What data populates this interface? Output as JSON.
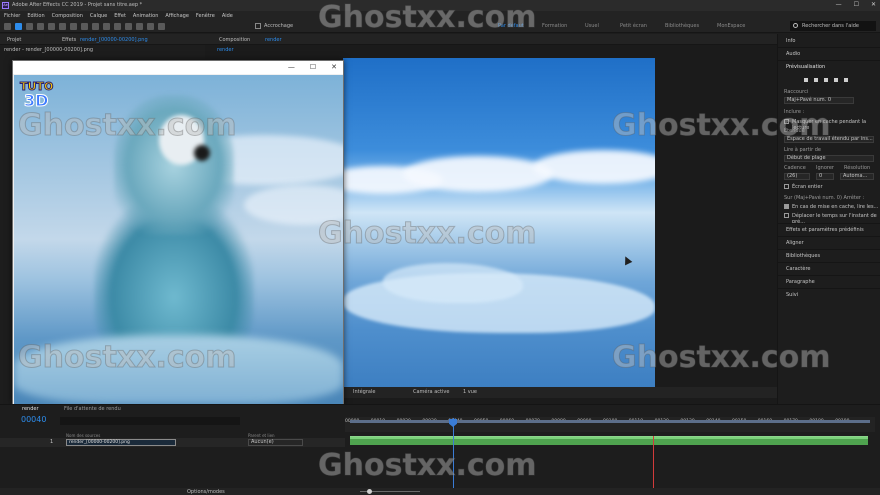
{
  "app": {
    "title": "Adobe After Effects CC 2019 - Projet sans titre.aep *",
    "logo_text": "Ae",
    "window_controls": [
      "—",
      "☐",
      "✕"
    ]
  },
  "menu": [
    "Fichier",
    "Edition",
    "Composition",
    "Calque",
    "Effet",
    "Animation",
    "Affichage",
    "Fenêtre",
    "Aide"
  ],
  "toolbar": {
    "snap_label": "Accrochage",
    "workspaces": [
      {
        "label": "Par défaut",
        "active": true
      },
      {
        "label": "Formation",
        "active": false
      },
      {
        "label": "Usuel",
        "active": false
      },
      {
        "label": "Petit écran",
        "active": false
      },
      {
        "label": "Bibliothèques",
        "active": false
      },
      {
        "label": "MonEspace",
        "active": false
      }
    ],
    "search_help_placeholder": "Rechercher dans l'aide"
  },
  "project_panel": {
    "tab_project": "Projet",
    "tab_effects_prefix": "Effets",
    "tab_effects_name": "render_[00000-00200].png",
    "file_name": "render - render_[00000-00200].png"
  },
  "composition_panel": {
    "tab_label": "Composition",
    "comp_name": "render",
    "sub_tab": "render",
    "bottom_controls": {
      "resolution": "Intégrale",
      "camera": "Caméra active",
      "views": "1 vue"
    }
  },
  "popup": {
    "logo_line1": "TUTO",
    "logo_line2": "3D",
    "controls": [
      "—",
      "☐",
      "✕"
    ]
  },
  "right_panel": {
    "info": "Info",
    "audio": "Audio",
    "preview": "Prévisualisation",
    "raccourci_label": "Raccourci",
    "raccourci_value": "Maj+Pavé num. 0",
    "inclure": "Inclure :",
    "masquer_lecture": "Masquer en cache pendant la lecture",
    "etendue_label": "Étendue",
    "etendue_value": "Espace de travail étendu par ins...",
    "lire_partir": "Lire à partir de",
    "lire_value": "Début de plage",
    "cadence": "Cadence",
    "ignorer": "Ignorer",
    "resolution": "Résolution",
    "cadence_value": "(26)",
    "ignorer_value": "0",
    "resolution_value": "Automa...",
    "ecran_entier": "Écran entier",
    "sur_label": "Sur (Maj+Pavé num. 0) Arrêter :",
    "cache_label": "En cas de mise en cache, lire les...",
    "deplacer_label": "Déplacer le temps sur l'instant de pré...",
    "effets_presets": "Effets et paramètres prédéfinis",
    "aligner": "Aligner",
    "bibliotheques": "Bibliothèques",
    "caractere": "Caractère",
    "paragraphe": "Paragraphe",
    "suivi": "Suivi"
  },
  "timeline": {
    "tab_render": "render",
    "tab_queue": "File d'attente de rendu",
    "timecode": "00040",
    "columns": [
      "Nom des sources",
      "Parent et lien"
    ],
    "layer": {
      "number": "1",
      "name": "render_[00000-00200].png",
      "parent": "Aucun(e)"
    },
    "ruler_labels": [
      "00000",
      "00010",
      "00020",
      "00030",
      "00040",
      "00050",
      "00060",
      "00070",
      "00080",
      "00090",
      "00100",
      "00110",
      "00120",
      "00130",
      "00140",
      "00150",
      "00160",
      "00170",
      "00180",
      "00190"
    ],
    "options_modes": "Options/modes"
  },
  "watermark": "Ghostxx.com",
  "colors": {
    "accent_blue": "#2d8ceb",
    "layer_green": "#4fa34f",
    "end_red": "#d23b3b",
    "panel_bg": "#1d1d1d"
  }
}
